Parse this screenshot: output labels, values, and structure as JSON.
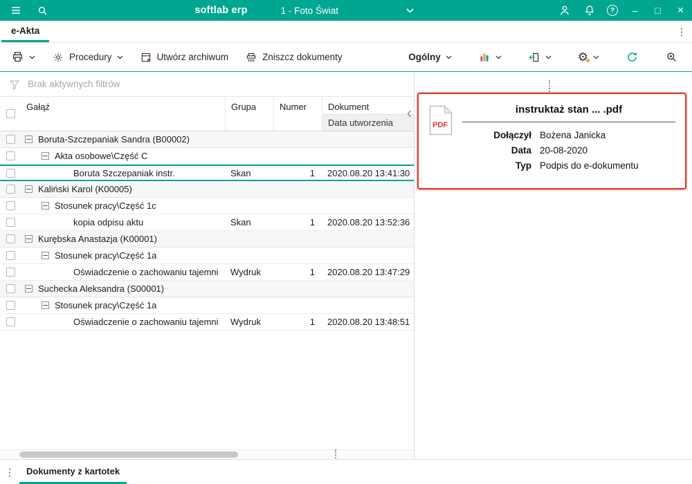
{
  "topbar": {
    "app_name": "softlab erp",
    "company": "1 - Foto Świat"
  },
  "icons": {
    "help_glyph": "?",
    "minimize_glyph": "–",
    "maximize_glyph": "□",
    "close_glyph": "×",
    "kebab_glyph": "⋮",
    "gear_glyph": "⚙"
  },
  "tabbar": {
    "active_tab": "e-Akta"
  },
  "toolbar": {
    "procedures": "Procedury",
    "create_archive": "Utwórz archiwum",
    "destroy_documents": "Zniszcz dokumenty",
    "view": "Ogólny"
  },
  "filters": {
    "status": "Brak aktywnych filtrów"
  },
  "table": {
    "headers": {
      "branch": "Gałąź",
      "group": "Grupa",
      "number": "Numer",
      "document": "Dokument",
      "created": "Data utworzenia"
    },
    "rows": [
      {
        "level": 0,
        "expandable": true,
        "label": "Boruta-Szczepaniak Sandra (B00002)"
      },
      {
        "level": 1,
        "expandable": true,
        "label": "Akta osobowe\\Część C"
      },
      {
        "level": 2,
        "label": "Boruta Szczepaniak instr.",
        "group": "Skan",
        "number": "1",
        "created": "2020.08.20 13:41:30",
        "selected": true
      },
      {
        "level": 0,
        "expandable": true,
        "label": "Kaliński Karol (K00005)"
      },
      {
        "level": 1,
        "expandable": true,
        "label": "Stosunek pracy\\Część 1c"
      },
      {
        "level": 2,
        "label": "kopia odpisu aktu",
        "group": "Skan",
        "number": "1",
        "created": "2020.08.20 13:52:36"
      },
      {
        "level": 0,
        "expandable": true,
        "label": "Kurębska Anastazja (K00001)"
      },
      {
        "level": 1,
        "expandable": true,
        "label": "Stosunek pracy\\Część 1a"
      },
      {
        "level": 2,
        "label": "Oświadczenie o zachowaniu tajemni",
        "group": "Wydruk",
        "number": "1",
        "created": "2020.08.20 13:47:29"
      },
      {
        "level": 0,
        "expandable": true,
        "label": "Suchecka Aleksandra (S00001)"
      },
      {
        "level": 1,
        "expandable": true,
        "label": "Stosunek pracy\\Część 1a"
      },
      {
        "level": 2,
        "label": "Oświadczenie o zachowaniu tajemni",
        "group": "Wydruk",
        "number": "1",
        "created": "2020.08.20 13:48:51"
      }
    ]
  },
  "detail": {
    "title": "instruktaż stan ... .pdf",
    "file_type_label": "PDF",
    "fields": [
      {
        "label": "Dołączył",
        "value": "Bożena Janicka"
      },
      {
        "label": "Data",
        "value": "20-08-2020"
      },
      {
        "label": "Typ",
        "value": "Podpis do e-dokumentu"
      }
    ]
  },
  "bottombar": {
    "tab": "Dokumenty z kartotek"
  },
  "colors": {
    "accent": "#00a690",
    "alert": "#df362e"
  }
}
